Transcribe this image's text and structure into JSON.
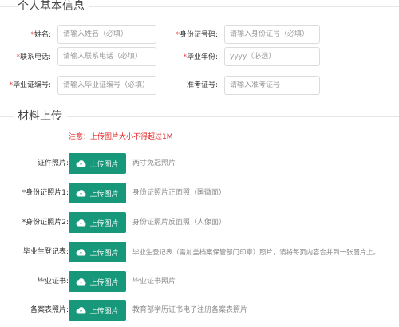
{
  "basic_info": {
    "title": "个人基本信息",
    "fields": [
      {
        "label_req": "*",
        "label": "姓名:",
        "placeholder": "请输入姓名（必填）"
      },
      {
        "label_req": "*",
        "label": "身份证号码:",
        "placeholder": "请输入身份证号（必填）"
      },
      {
        "label_req": "*",
        "label": "联系电话:",
        "placeholder": "请输入联系电话（必填）"
      },
      {
        "label_req": "*",
        "label": "毕业年份:",
        "placeholder": "yyyy（必选）"
      },
      {
        "label_req": "*",
        "label": "毕业证编号:",
        "placeholder": "请输入毕业证编号（必填）"
      },
      {
        "label_req": "",
        "label": "准考证号:",
        "placeholder": "请输入准考证号"
      }
    ]
  },
  "upload_section": {
    "title": "材料上传",
    "notice": "注意：上传图片大小不得超过1M",
    "button_label": "上传图片",
    "items": [
      {
        "label": "证件照片:",
        "hint": "两寸免冠照片"
      },
      {
        "label": "*身份证照片1:",
        "hint": "身份证照片正面照（国徽面）"
      },
      {
        "label": "*身份证照片2:",
        "hint": "身份证照片反面照（人像面）"
      },
      {
        "label": "毕业生登记表:",
        "hint": "毕业生登记表（需加盖档案保管部门印章）照片，请将每页内容合并到一张图片上。"
      },
      {
        "label": "毕业证书:",
        "hint": "毕业证书照片"
      },
      {
        "label": "备案表照片:",
        "hint": "教育部学历证书电子注册备案表照片"
      }
    ]
  },
  "colors": {
    "button": "#17987a",
    "required": "#e23a3a",
    "notice": "#e02020"
  },
  "icons": {
    "upload_button_icon": "cloud-upload-icon"
  }
}
